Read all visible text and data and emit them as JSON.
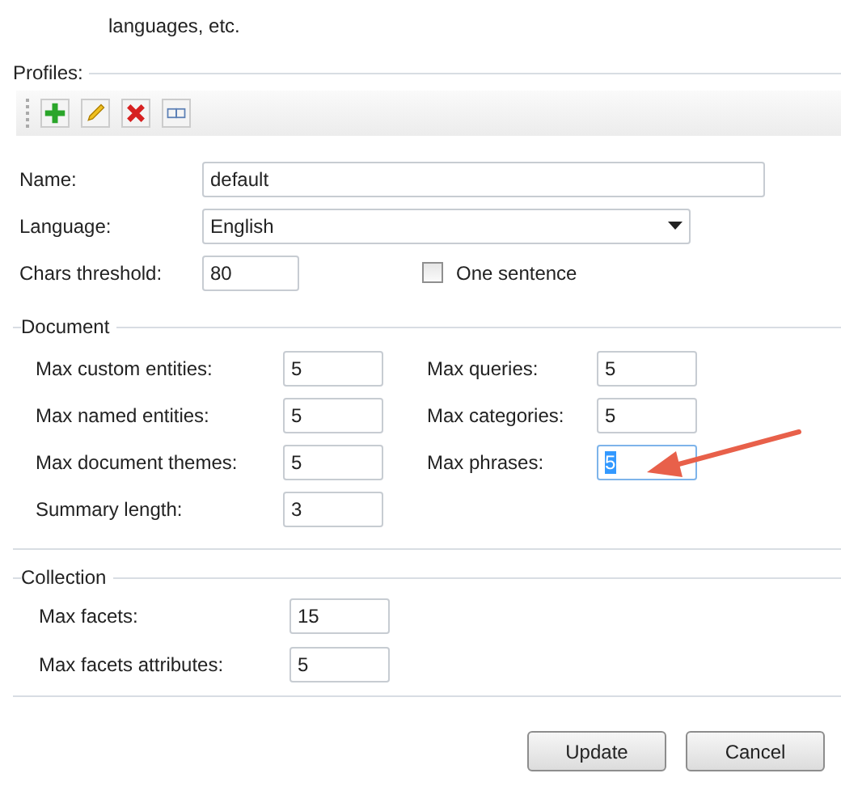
{
  "intro_text": "languages, etc.",
  "profiles": {
    "legend": "Profiles:",
    "name": {
      "label": "Name:",
      "value": "default"
    },
    "language": {
      "label": "Language:",
      "value": "English"
    },
    "chars_threshold": {
      "label": "Chars threshold:",
      "value": "80"
    },
    "one_sentence": {
      "label": "One sentence",
      "checked": false
    }
  },
  "document": {
    "legend": "Document",
    "left": [
      {
        "label": "Max custom entities:",
        "value": "5",
        "highlighted": false
      },
      {
        "label": "Max named entities:",
        "value": "5",
        "highlighted": false
      },
      {
        "label": "Max document themes:",
        "value": "5",
        "highlighted": false
      },
      {
        "label": "Summary length:",
        "value": "3",
        "highlighted": false
      }
    ],
    "right": [
      {
        "label": "Max queries:",
        "value": "5",
        "highlighted": false
      },
      {
        "label": "Max categories:",
        "value": "5",
        "highlighted": false
      },
      {
        "label": "Max phrases:",
        "value": "5",
        "highlighted": true
      }
    ]
  },
  "collection": {
    "legend": "Collection",
    "fields": [
      {
        "label": "Max facets:",
        "value": "15",
        "highlighted": false
      },
      {
        "label": "Max facets attributes:",
        "value": "5",
        "highlighted": false
      }
    ]
  },
  "buttons": [
    "Update",
    "Cancel"
  ]
}
